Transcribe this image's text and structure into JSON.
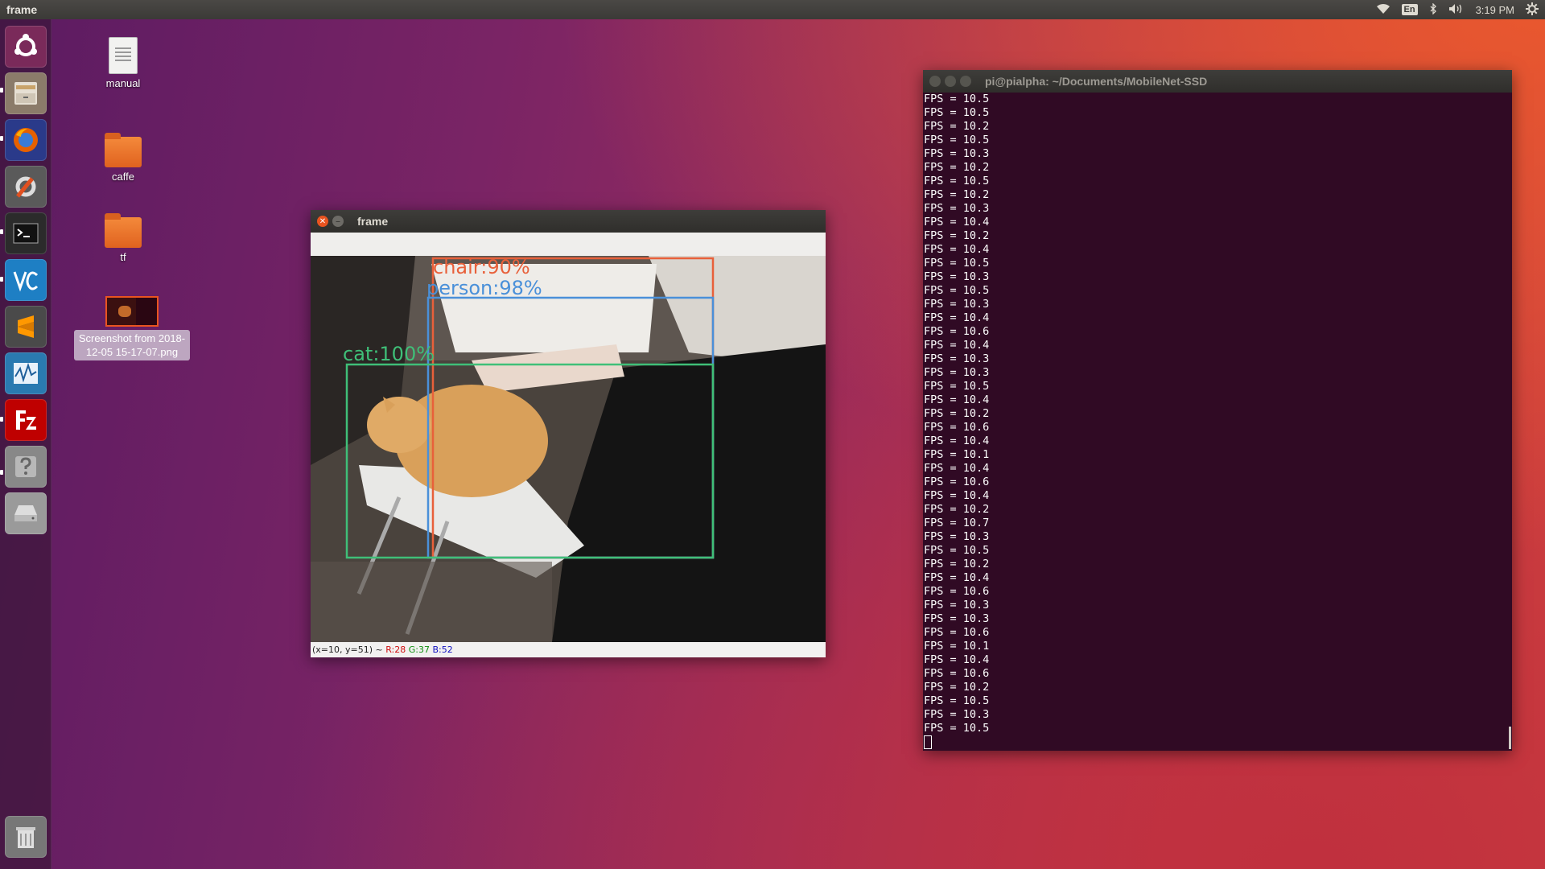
{
  "top_panel": {
    "app_title": "frame",
    "wifi_icon": "wifi-icon",
    "keyboard_layout": "En",
    "bluetooth_icon": "bluetooth-icon",
    "volume_icon": "volume-icon",
    "clock": "3:19 PM",
    "system_menu_icon": "gear-icon"
  },
  "launcher": {
    "items": [
      {
        "name": "ubuntu-dash",
        "icon": "ubuntu-logo-icon",
        "color": "#7a2a5a"
      },
      {
        "name": "files",
        "icon": "file-cabinet-icon",
        "color": "#8b7b6a"
      },
      {
        "name": "firefox",
        "icon": "firefox-icon",
        "color": "#e66000"
      },
      {
        "name": "system-settings",
        "icon": "settings-wrench-icon",
        "color": "#5a5a5a"
      },
      {
        "name": "terminal",
        "icon": "terminal-icon",
        "color": "#2b2b2b"
      },
      {
        "name": "vnc-viewer",
        "icon": "vnc-icon",
        "color": "#1e7fc4"
      },
      {
        "name": "sublime-text",
        "icon": "sublime-icon",
        "color": "#4a4a4a"
      },
      {
        "name": "system-monitor",
        "icon": "monitor-graph-icon",
        "color": "#2a7ab0"
      },
      {
        "name": "filezilla",
        "icon": "filezilla-icon",
        "color": "#bf0000"
      },
      {
        "name": "help",
        "icon": "help-icon",
        "color": "#888888"
      },
      {
        "name": "disk-drive",
        "icon": "disk-icon",
        "color": "#9a9a9a"
      },
      {
        "name": "trash",
        "icon": "trash-icon",
        "color": "#777777"
      }
    ]
  },
  "desktop": {
    "icons": [
      {
        "label": "manual",
        "type": "document"
      },
      {
        "label": "caffe",
        "type": "folder"
      },
      {
        "label": "tf",
        "type": "folder"
      },
      {
        "label": "Screenshot from 2018-12-05 15-17-07.png",
        "type": "image"
      }
    ]
  },
  "frame_window": {
    "title": "frame",
    "close_icon": "close-icon",
    "minimize_icon": "minimize-icon",
    "detections": [
      {
        "label": "chair:90%",
        "color": "#e8603a"
      },
      {
        "label": "person:98%",
        "color": "#4a90d9"
      },
      {
        "label": "cat:100%",
        "color": "#3fbf78"
      }
    ],
    "status": {
      "coords": "(x=10, y=51) ~",
      "r": "R:28",
      "g": "G:37",
      "b": "B:52"
    }
  },
  "terminal": {
    "title": "pi@pialpha: ~/Documents/MobileNet-SSD",
    "lines": [
      "FPS = 10.5",
      "FPS = 10.5",
      "FPS = 10.2",
      "FPS = 10.5",
      "FPS = 10.3",
      "FPS = 10.2",
      "FPS = 10.5",
      "FPS = 10.2",
      "FPS = 10.3",
      "FPS = 10.4",
      "FPS = 10.2",
      "FPS = 10.4",
      "FPS = 10.5",
      "FPS = 10.3",
      "FPS = 10.5",
      "FPS = 10.3",
      "FPS = 10.4",
      "FPS = 10.6",
      "FPS = 10.4",
      "FPS = 10.3",
      "FPS = 10.3",
      "FPS = 10.5",
      "FPS = 10.4",
      "FPS = 10.2",
      "FPS = 10.6",
      "FPS = 10.4",
      "FPS = 10.1",
      "FPS = 10.4",
      "FPS = 10.6",
      "FPS = 10.4",
      "FPS = 10.2",
      "FPS = 10.7",
      "FPS = 10.3",
      "FPS = 10.5",
      "FPS = 10.2",
      "FPS = 10.4",
      "FPS = 10.6",
      "FPS = 10.3",
      "FPS = 10.3",
      "FPS = 10.6",
      "FPS = 10.1",
      "FPS = 10.4",
      "FPS = 10.6",
      "FPS = 10.2",
      "FPS = 10.5",
      "FPS = 10.3",
      "FPS = 10.5"
    ]
  }
}
